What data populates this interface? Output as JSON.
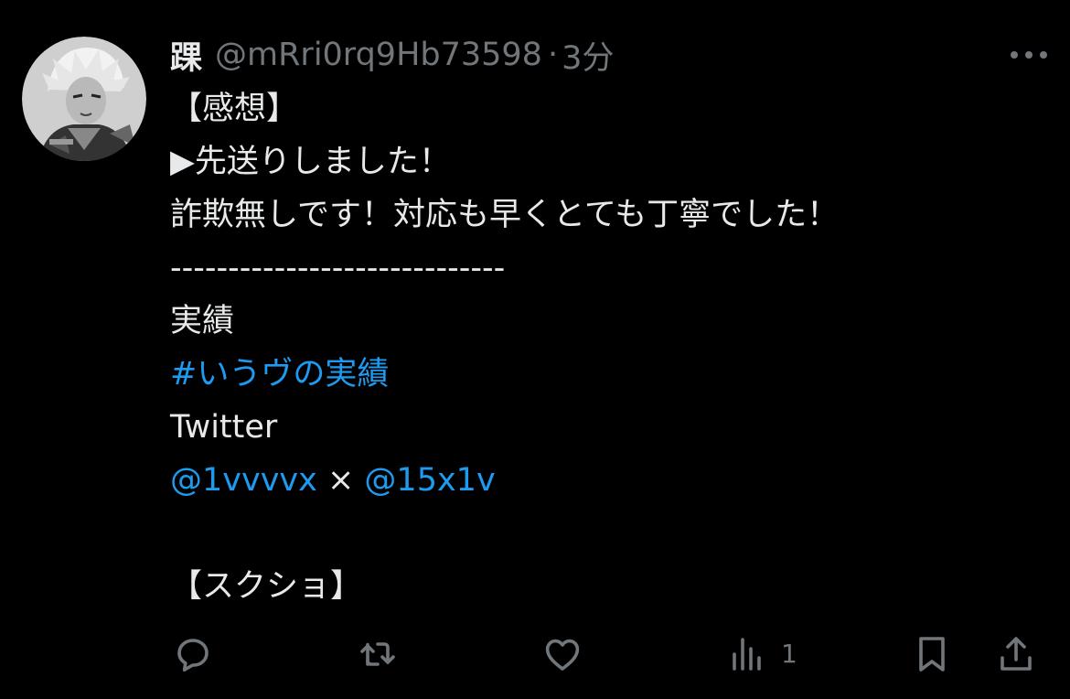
{
  "tweet": {
    "display_name": "踝",
    "handle": "@mRri0rq9Hb73598",
    "separator": "·",
    "time": "3分",
    "lines": {
      "l1": "【感想】",
      "l2": "▶︎先送りしました！",
      "l3": "詐欺無しです！対応も早くとても丁寧でした！",
      "l4": "-----------------------------",
      "l5": "実績",
      "hashtag": "#いうヴの実績",
      "l7": "Twitter",
      "mention1": "@1vvvvx",
      "times": " × ",
      "mention2": "@15x1v",
      "l10": "【スクショ】"
    }
  },
  "actions": {
    "views_count": "1"
  },
  "colors": {
    "background": "#000000",
    "text": "#e7e9ea",
    "muted": "#71767b",
    "link": "#1d9bf0"
  }
}
